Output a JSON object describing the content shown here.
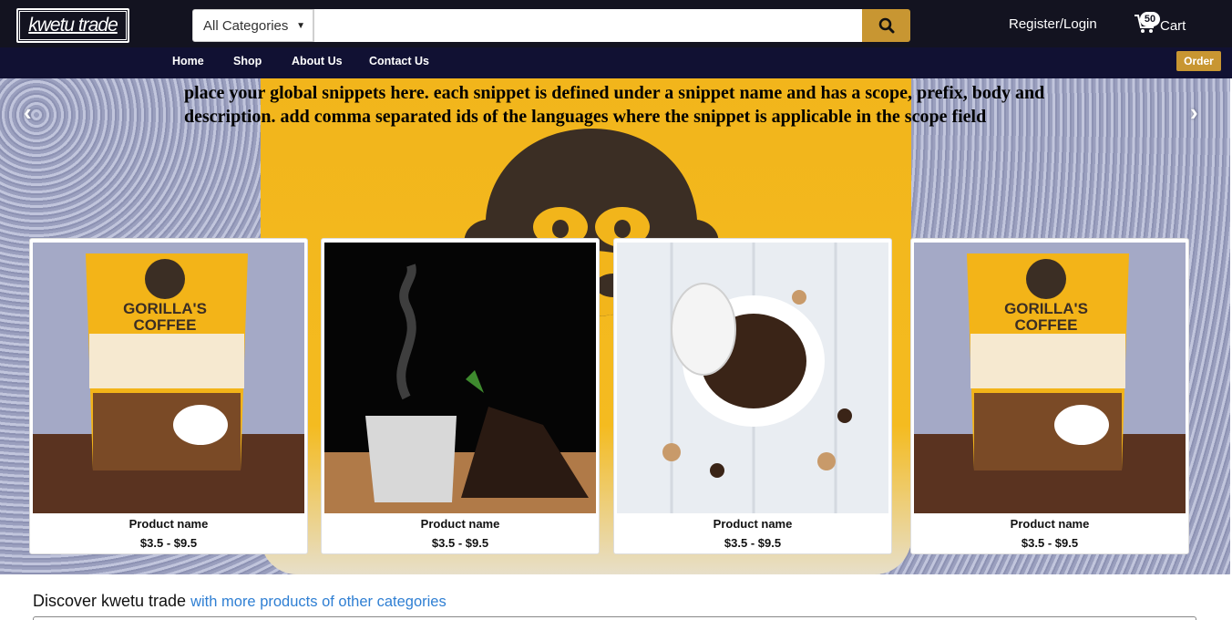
{
  "header": {
    "logo_text": "kwetu trade",
    "category_select": "All Categories",
    "search_placeholder": "",
    "search_icon": "search-icon",
    "register_login": "Register/Login",
    "cart_count": "50",
    "cart_label": "Cart",
    "accent_color": "#c89632"
  },
  "nav": {
    "items": [
      "Home",
      "Shop",
      "About Us",
      "Contact Us"
    ],
    "order_label": "Order"
  },
  "hero": {
    "text": "place your global snippets here. each snippet is defined under a snippet name and has a scope, prefix, body and description. add comma separated ids of the languages where the snippet is applicable in the scope field",
    "prev_icon": "chevron-left-icon",
    "next_icon": "chevron-right-icon"
  },
  "products": [
    {
      "name": "Product name",
      "price": "$3.5 - $9.5",
      "image": "coffee-bag-image"
    },
    {
      "name": "Product name",
      "price": "$3.5 - $9.5",
      "image": "steaming-coffee-cup-image"
    },
    {
      "name": "Product name",
      "price": "$3.5 - $9.5",
      "image": "coffee-beans-cup-image"
    },
    {
      "name": "Product name",
      "price": "$3.5 - $9.5",
      "image": "coffee-bag-image"
    }
  ],
  "discover": {
    "prefix": "Discover kwetu trade",
    "link": "with more products of other categories"
  }
}
